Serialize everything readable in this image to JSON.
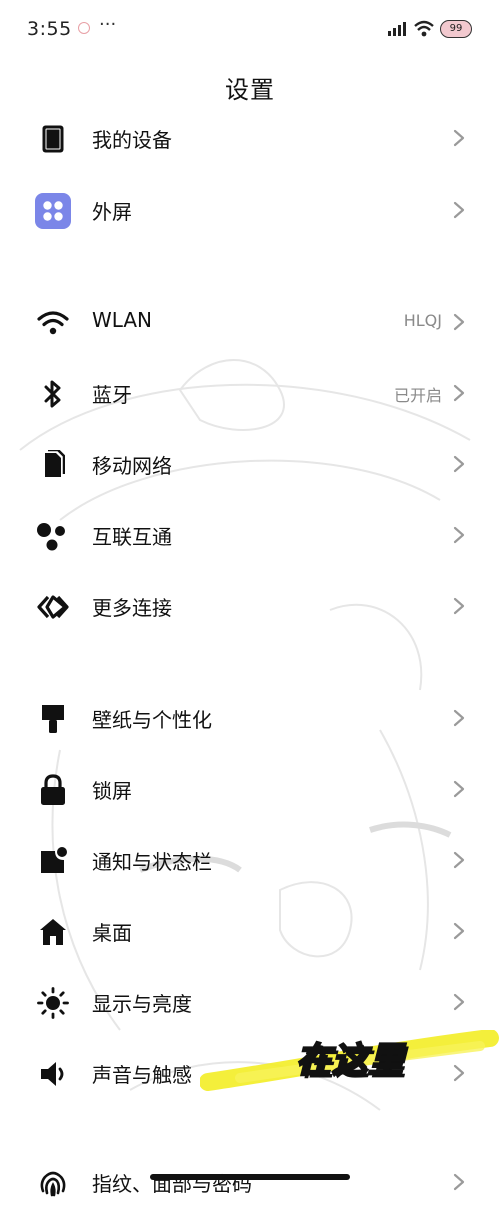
{
  "status_bar": {
    "time": "3:55",
    "dots": "···",
    "battery": "99"
  },
  "page": {
    "title": "设置"
  },
  "settings": [
    {
      "label": "我的设备",
      "value": "",
      "icon": "tablet-icon"
    },
    {
      "label": "外屏",
      "value": "",
      "icon": "outer-screen-icon"
    },
    {
      "label": "WLAN",
      "value": "HLQJ",
      "icon": "wifi-icon"
    },
    {
      "label": "蓝牙",
      "value": "已开启",
      "icon": "bluetooth-icon"
    },
    {
      "label": "移动网络",
      "value": "",
      "icon": "sim-card-icon"
    },
    {
      "label": "互联互通",
      "value": "",
      "icon": "interconnect-icon"
    },
    {
      "label": "更多连接",
      "value": "",
      "icon": "more-connections-icon"
    },
    {
      "label": "壁纸与个性化",
      "value": "",
      "icon": "paint-brush-icon"
    },
    {
      "label": "锁屏",
      "value": "",
      "icon": "lock-icon"
    },
    {
      "label": "通知与状态栏",
      "value": "",
      "icon": "notification-icon"
    },
    {
      "label": "桌面",
      "value": "",
      "icon": "home-icon"
    },
    {
      "label": "显示与亮度",
      "value": "",
      "icon": "brightness-icon"
    },
    {
      "label": "声音与触感",
      "value": "",
      "icon": "speaker-icon"
    },
    {
      "label": "指纹、面部与密码",
      "value": "",
      "icon": "fingerprint-icon"
    }
  ],
  "annotation": {
    "text": "在这里"
  },
  "colors": {
    "accent_tile": "#7b86e8",
    "highlighter": "#f3ee2a",
    "value_text": "#8a8a8a"
  }
}
